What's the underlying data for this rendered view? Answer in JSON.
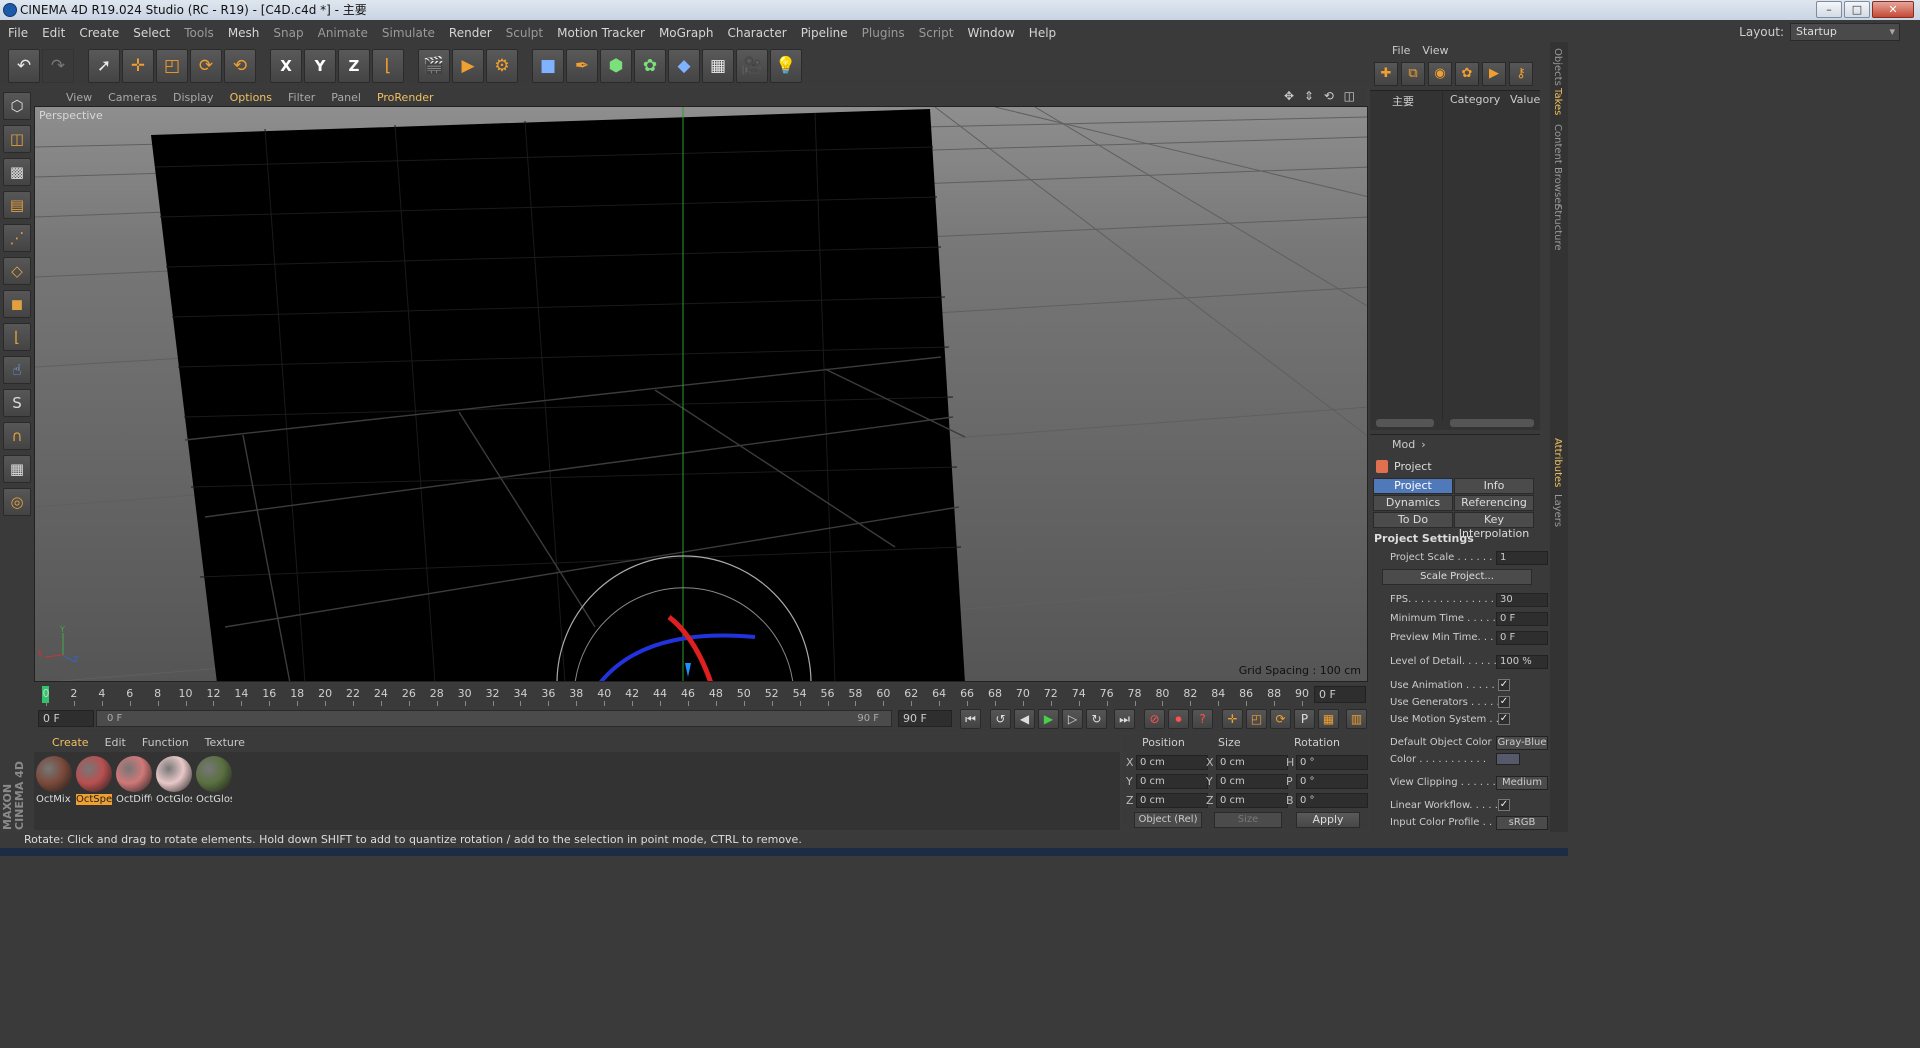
{
  "window": {
    "title": "CINEMA 4D R19.024 Studio (RC - R19) - [C4D.c4d *] - 主要"
  },
  "menubar": {
    "items": [
      "File",
      "Edit",
      "Create",
      "Select",
      "Tools",
      "Mesh",
      "Snap",
      "Animate",
      "Simulate",
      "Render",
      "Sculpt",
      "Motion Tracker",
      "MoGraph",
      "Character",
      "Pipeline",
      "Plugins",
      "Script",
      "Window",
      "Help"
    ],
    "layout_label": "Layout:",
    "layout_value": "Startup"
  },
  "toolbar": {
    "icons": [
      "undo-icon",
      "redo-icon",
      "live-selection-icon",
      "move-icon",
      "scale-icon",
      "rotate-icon",
      "recent-tools-icon",
      "x-axis-lock-icon",
      "y-axis-lock-icon",
      "z-axis-lock-icon",
      "coordinate-system-icon",
      "render-view-icon",
      "render-picture-viewer-icon",
      "render-settings-icon",
      "cube-icon",
      "pen-spline-icon",
      "subdivision-icon",
      "cloner-icon",
      "deformer-icon",
      "floor-environment-icon",
      "camera-icon",
      "light-icon"
    ],
    "axis_labels": [
      "X",
      "Y",
      "Z"
    ]
  },
  "viewport": {
    "menu": [
      "View",
      "Cameras",
      "Display",
      "Options",
      "Filter",
      "Panel",
      "ProRender"
    ],
    "active_menu": "Options",
    "label": "Perspective",
    "grid_spacing": "Grid Spacing : 100 cm",
    "axes": {
      "x": "X",
      "y": "Y",
      "z": "Z"
    }
  },
  "timeline": {
    "ticks": [
      0,
      2,
      4,
      6,
      8,
      10,
      12,
      14,
      16,
      18,
      20,
      22,
      24,
      26,
      28,
      30,
      32,
      34,
      36,
      38,
      40,
      42,
      44,
      46,
      48,
      50,
      52,
      54,
      56,
      58,
      60,
      62,
      64,
      66,
      68,
      70,
      72,
      74,
      76,
      78,
      80,
      82,
      84,
      86,
      88,
      90
    ],
    "current_frame": "0 F",
    "start_field": "0 F",
    "range_start": "0 F",
    "range_end": "90 F",
    "end_field": "90 F"
  },
  "materials": {
    "menu": [
      "Create",
      "Edit",
      "Function",
      "Texture"
    ],
    "items": [
      {
        "label": "OctMix",
        "color": "#7a4a3a"
      },
      {
        "label": "OctSpec",
        "color": "#b85050"
      },
      {
        "label": "OctDiffu",
        "color": "#d07878"
      },
      {
        "label": "OctGlos",
        "color": "#e8c8c8"
      },
      {
        "label": "OctGlos",
        "color": "#5a7040"
      }
    ],
    "selected_index": 1,
    "logo": "MAXON CINEMA 4D"
  },
  "coordinates": {
    "headers": [
      "Position",
      "Size",
      "Rotation"
    ],
    "position": [
      {
        "axis": "X",
        "value": "0 cm"
      },
      {
        "axis": "Y",
        "value": "0 cm"
      },
      {
        "axis": "Z",
        "value": "0 cm"
      }
    ],
    "size": [
      {
        "axis": "X",
        "value": "0 cm"
      },
      {
        "axis": "Y",
        "value": "0 cm"
      },
      {
        "axis": "Z",
        "value": "0 cm"
      }
    ],
    "rotation": [
      {
        "axis": "H",
        "value": "0 °"
      },
      {
        "axis": "P",
        "value": "0 °"
      },
      {
        "axis": "B",
        "value": "0 °"
      }
    ],
    "mode": "Object (Rel)",
    "size_mode": "Size",
    "apply": "Apply"
  },
  "status": "Rotate: Click and drag to rotate elements. Hold down SHIFT to add to quantize rotation / add to the selection in point mode, CTRL to remove.",
  "takes_panel": {
    "menu": [
      "File",
      "View"
    ],
    "take_name": "主要",
    "columns": [
      "Category",
      "Value"
    ]
  },
  "attributes": {
    "mode": "Mod",
    "object": "Project",
    "tabs": [
      "Project Settings",
      "Info",
      "Dynamics",
      "Referencing",
      "To Do",
      "Key Interpolation"
    ],
    "active_tab": "Project Settings",
    "group": "Project Settings",
    "scale_button": "Scale Project...",
    "props": {
      "project_scale": {
        "label": "Project Scale . . . . . . . .",
        "value": "1"
      },
      "fps": {
        "label": "FPS. . . . . . . . . . . . . . . .",
        "value": "30"
      },
      "min_time": {
        "label": "Minimum Time . . . . . .",
        "value": "0 F"
      },
      "preview_min": {
        "label": "Preview Min Time. . . .",
        "value": "0 F"
      },
      "lod": {
        "label": "Level of Detail. . . . . .",
        "value": "100 %"
      },
      "use_animation": {
        "label": "Use Animation . . . . . .",
        "checked": "✓"
      },
      "use_generators": {
        "label": "Use Generators . . . . .",
        "checked": "✓"
      },
      "use_motion": {
        "label": "Use Motion System . . .",
        "checked": "✓"
      },
      "default_color": {
        "label": "Default Object Color",
        "value": "Gray-Blue"
      },
      "color": {
        "label": "Color . . . . . . . . . . ."
      },
      "view_clipping": {
        "label": "View Clipping . . . . . .",
        "value": "Medium"
      },
      "linear_workflow": {
        "label": "Linear Workflow. . . . .",
        "checked": "✓"
      },
      "input_profile": {
        "label": "Input Color Profile . . .",
        "value": "sRGB"
      }
    }
  },
  "side_tabs": [
    "Objects",
    "Takes",
    "Content Browser",
    "Structure",
    "Attributes",
    "Layers"
  ],
  "active_side_tab": "Takes",
  "colors": {
    "accent": "#f0c060",
    "selection": "#4f79b8",
    "play": "#48d048"
  }
}
